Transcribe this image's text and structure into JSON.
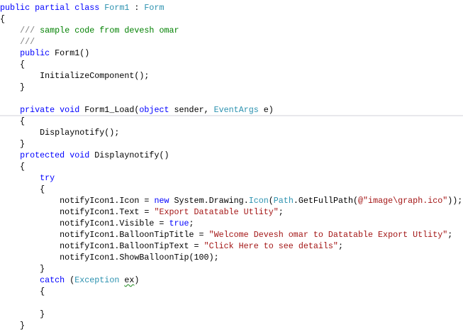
{
  "editor": {
    "lines": [
      [
        {
          "t": "public partial class ",
          "c": "kw"
        },
        {
          "t": "Form1",
          "c": "ty"
        },
        {
          "t": " : ",
          "c": "pl"
        },
        {
          "t": "Form",
          "c": "ty"
        }
      ],
      [
        {
          "t": "{",
          "c": "pl"
        }
      ],
      [
        {
          "t": "    ",
          "c": "pl"
        },
        {
          "t": "///",
          "c": "cd"
        },
        {
          "t": " sample code from devesh omar",
          "c": "cm"
        }
      ],
      [
        {
          "t": "    ",
          "c": "pl"
        },
        {
          "t": "///",
          "c": "cd"
        }
      ],
      [
        {
          "t": "    ",
          "c": "pl"
        },
        {
          "t": "public",
          "c": "kw"
        },
        {
          "t": " Form1()",
          "c": "pl"
        }
      ],
      [
        {
          "t": "    {",
          "c": "pl"
        }
      ],
      [
        {
          "t": "        InitializeComponent();",
          "c": "pl"
        }
      ],
      [
        {
          "t": "    }",
          "c": "pl"
        }
      ],
      [],
      [
        {
          "t": "    ",
          "c": "pl"
        },
        {
          "t": "private void",
          "c": "kw"
        },
        {
          "t": " Form1_Load(",
          "c": "pl"
        },
        {
          "t": "object",
          "c": "kw"
        },
        {
          "t": " sender, ",
          "c": "pl"
        },
        {
          "t": "EventArgs",
          "c": "ty"
        },
        {
          "t": " e)",
          "c": "pl"
        }
      ],
      [
        {
          "t": "    {",
          "c": "pl"
        }
      ],
      [
        {
          "t": "        Displaynotify();",
          "c": "pl"
        }
      ],
      [
        {
          "t": "    }",
          "c": "pl"
        }
      ],
      [
        {
          "t": "    ",
          "c": "pl"
        },
        {
          "t": "protected void",
          "c": "kw"
        },
        {
          "t": " Displaynotify()",
          "c": "pl"
        }
      ],
      [
        {
          "t": "    {",
          "c": "pl"
        }
      ],
      [
        {
          "t": "        ",
          "c": "pl"
        },
        {
          "t": "try",
          "c": "kw"
        }
      ],
      [
        {
          "t": "        {",
          "c": "pl"
        }
      ],
      [
        {
          "t": "            notifyIcon1.Icon = ",
          "c": "pl"
        },
        {
          "t": "new",
          "c": "kw"
        },
        {
          "t": " System.Drawing.",
          "c": "pl"
        },
        {
          "t": "Icon",
          "c": "ty"
        },
        {
          "t": "(",
          "c": "pl"
        },
        {
          "t": "Path",
          "c": "ty"
        },
        {
          "t": ".GetFullPath(",
          "c": "pl"
        },
        {
          "t": "@\"image\\graph.ico\"",
          "c": "st"
        },
        {
          "t": "));",
          "c": "pl"
        }
      ],
      [
        {
          "t": "            notifyIcon1.Text = ",
          "c": "pl"
        },
        {
          "t": "\"Export Datatable Utlity\"",
          "c": "st"
        },
        {
          "t": ";",
          "c": "pl"
        }
      ],
      [
        {
          "t": "            notifyIcon1.Visible = ",
          "c": "pl"
        },
        {
          "t": "true",
          "c": "kw"
        },
        {
          "t": ";",
          "c": "pl"
        }
      ],
      [
        {
          "t": "            notifyIcon1.BalloonTipTitle = ",
          "c": "pl"
        },
        {
          "t": "\"Welcome Devesh omar to Datatable Export Utlity\"",
          "c": "st"
        },
        {
          "t": ";",
          "c": "pl"
        }
      ],
      [
        {
          "t": "            notifyIcon1.BalloonTipText = ",
          "c": "pl"
        },
        {
          "t": "\"Click Here to see details\"",
          "c": "st"
        },
        {
          "t": ";",
          "c": "pl"
        }
      ],
      [
        {
          "t": "            notifyIcon1.ShowBalloonTip(100);",
          "c": "pl"
        }
      ],
      [
        {
          "t": "        }",
          "c": "pl"
        }
      ],
      [
        {
          "t": "        ",
          "c": "pl"
        },
        {
          "t": "catch",
          "c": "kw"
        },
        {
          "t": " (",
          "c": "pl"
        },
        {
          "t": "Exception",
          "c": "ty"
        },
        {
          "t": " ",
          "c": "pl"
        },
        {
          "t": "ex",
          "c": "pl sq"
        },
        {
          "t": ")",
          "c": "pl"
        }
      ],
      [
        {
          "t": "        {",
          "c": "pl"
        }
      ],
      [],
      [
        {
          "t": "        }",
          "c": "pl"
        }
      ],
      [
        {
          "t": "    }",
          "c": "pl"
        }
      ]
    ],
    "colors": {
      "keyword": "#0000ff",
      "type": "#2b91af",
      "comment": "#008000",
      "doc_delimiter": "#808080",
      "string": "#a31515"
    }
  }
}
